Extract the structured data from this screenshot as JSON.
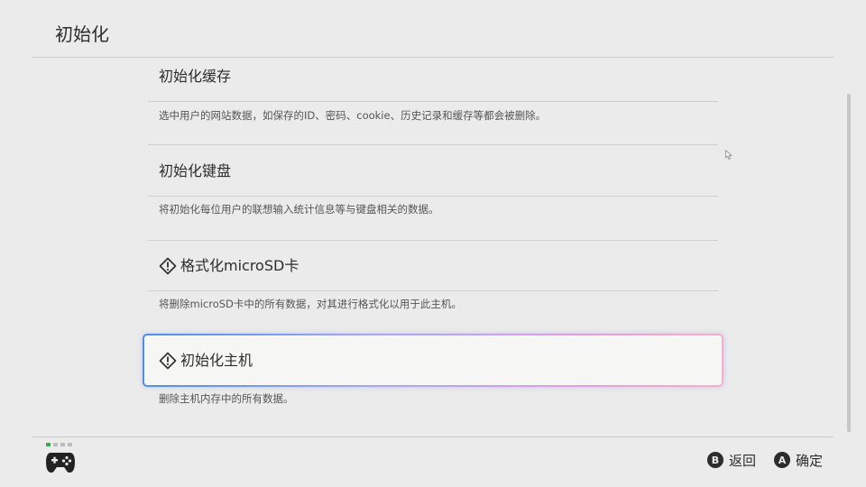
{
  "header": {
    "title": "初始化"
  },
  "items": [
    {
      "label": "初始化缓存",
      "description": "选中用户的网站数据，如保存的ID、密码、cookie、历史记录和缓存等都会被删除。",
      "warning": false
    },
    {
      "label": "初始化键盘",
      "description": "将初始化每位用户的联想输入统计信息等与键盘相关的数据。",
      "warning": false
    },
    {
      "label": "格式化microSD卡",
      "description": "将删除microSD卡中的所有数据，对其进行格式化以用于此主机。",
      "warning": true
    },
    {
      "label": "初始化主机",
      "description": "删除主机内存中的所有数据。",
      "warning": true,
      "selected": true
    }
  ],
  "footer": {
    "back_button": "B",
    "back_label": "返回",
    "confirm_button": "A",
    "confirm_label": "确定"
  },
  "colors": {
    "background": "#ebebeb",
    "selection_gradient": [
      "#4b8df0",
      "#e29ee0"
    ],
    "controller_indicator": "#2bb24c"
  }
}
